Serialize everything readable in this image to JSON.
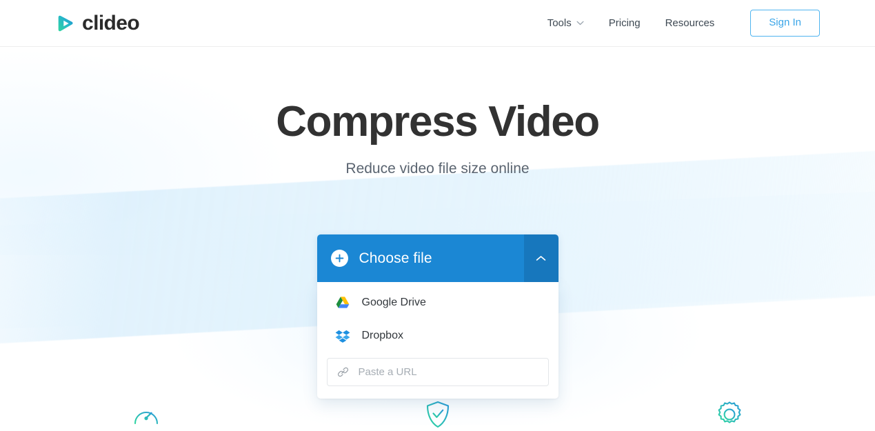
{
  "brand": {
    "name": "clideo",
    "logo_icon": "play-triangle-gradient-icon",
    "gradient_start": "#2fd6a0",
    "gradient_end": "#1b87d4"
  },
  "header": {
    "nav": [
      {
        "label": "Tools",
        "icon": "chevron-down-icon",
        "has_dropdown": true
      },
      {
        "label": "Pricing",
        "icon": "",
        "has_dropdown": false
      },
      {
        "label": "Resources",
        "icon": "",
        "has_dropdown": false
      }
    ],
    "signin_label": "Sign In",
    "signin_color": "#3aa5e8"
  },
  "hero": {
    "title": "Compress Video",
    "subtitle": "Reduce video file size online",
    "title_color": "#323232",
    "subtitle_color": "#5a6470"
  },
  "upload": {
    "choose_file_label": "Choose file",
    "plus_icon": "plus-icon",
    "toggle_icon": "chevron-up-icon",
    "button_color": "#1b87d4",
    "toggle_color": "#1777bd",
    "sources": [
      {
        "label": "Google Drive",
        "icon": "google-drive-icon"
      },
      {
        "label": "Dropbox",
        "icon": "dropbox-icon"
      }
    ],
    "url_field": {
      "icon": "link-icon",
      "placeholder": "Paste a URL",
      "value": ""
    }
  },
  "features": [
    {
      "icon": "speedometer-icon"
    },
    {
      "icon": "shield-check-icon"
    },
    {
      "icon": "gear-icon"
    }
  ]
}
